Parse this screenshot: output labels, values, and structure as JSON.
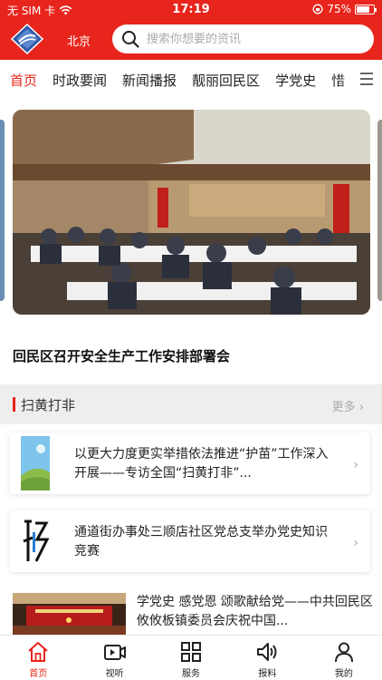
{
  "status_bar": {
    "carrier": "无 SIM 卡",
    "time": "17:19",
    "battery": "75%",
    "battery_level": 0.75
  },
  "header": {
    "city": "北京",
    "search_placeholder": "搜索你想要的资讯"
  },
  "nav_tabs": [
    "首页",
    "时政要闻",
    "新闻播报",
    "靓丽回民区",
    "学党史",
    "惜"
  ],
  "featured": {
    "headline": "回民区召开安全生产工作安排部署会"
  },
  "section": {
    "title": "扫黄打非",
    "more": "更多"
  },
  "cards": [
    {
      "text": "以更大力度更实举措依法推进“护苗”工作深入开展——专访全国“扫黄打非”..."
    },
    {
      "text": "通道街办事处三顺店社区党总支举办党史知识竞赛"
    }
  ],
  "news": [
    {
      "text": "学党史 感党恩 颂歌献给党——中共回民区攸攸板镇委员会庆祝中国..."
    }
  ],
  "tab_bar": [
    "首页",
    "视听",
    "服务",
    "报料",
    "我的"
  ],
  "colors": {
    "brand": "#e8251c",
    "section_bg": "#eeeeee"
  }
}
